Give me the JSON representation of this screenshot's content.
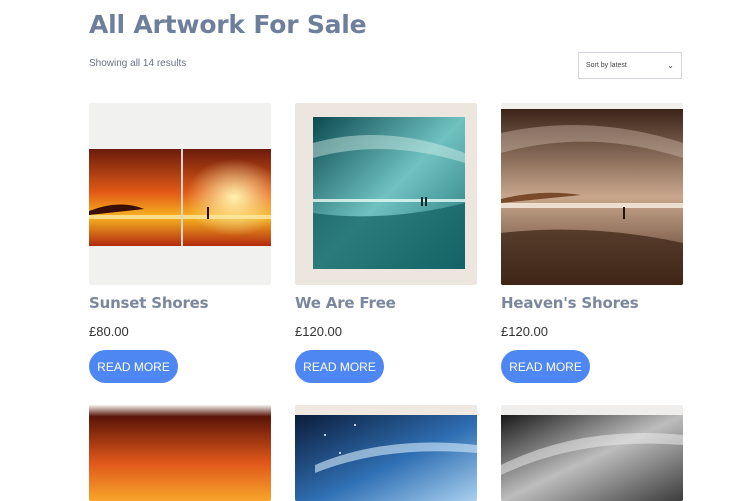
{
  "page": {
    "title": "All Artwork For Sale",
    "result_count": "Showing all 14 results"
  },
  "sort": {
    "selected": "Sort by latest"
  },
  "products": [
    {
      "title": "Sunset Shores",
      "price": "£80.00",
      "button": "READ MORE"
    },
    {
      "title": "We Are Free",
      "price": "£120.00",
      "button": "READ MORE"
    },
    {
      "title": "Heaven's Shores",
      "price": "£120.00",
      "button": "READ MORE"
    }
  ],
  "colors": {
    "accent": "#4e87f2",
    "title": "#6d7f9b",
    "product_title": "#7a879c"
  },
  "icons": {
    "sort_chevron": "chevron-down-icon"
  }
}
